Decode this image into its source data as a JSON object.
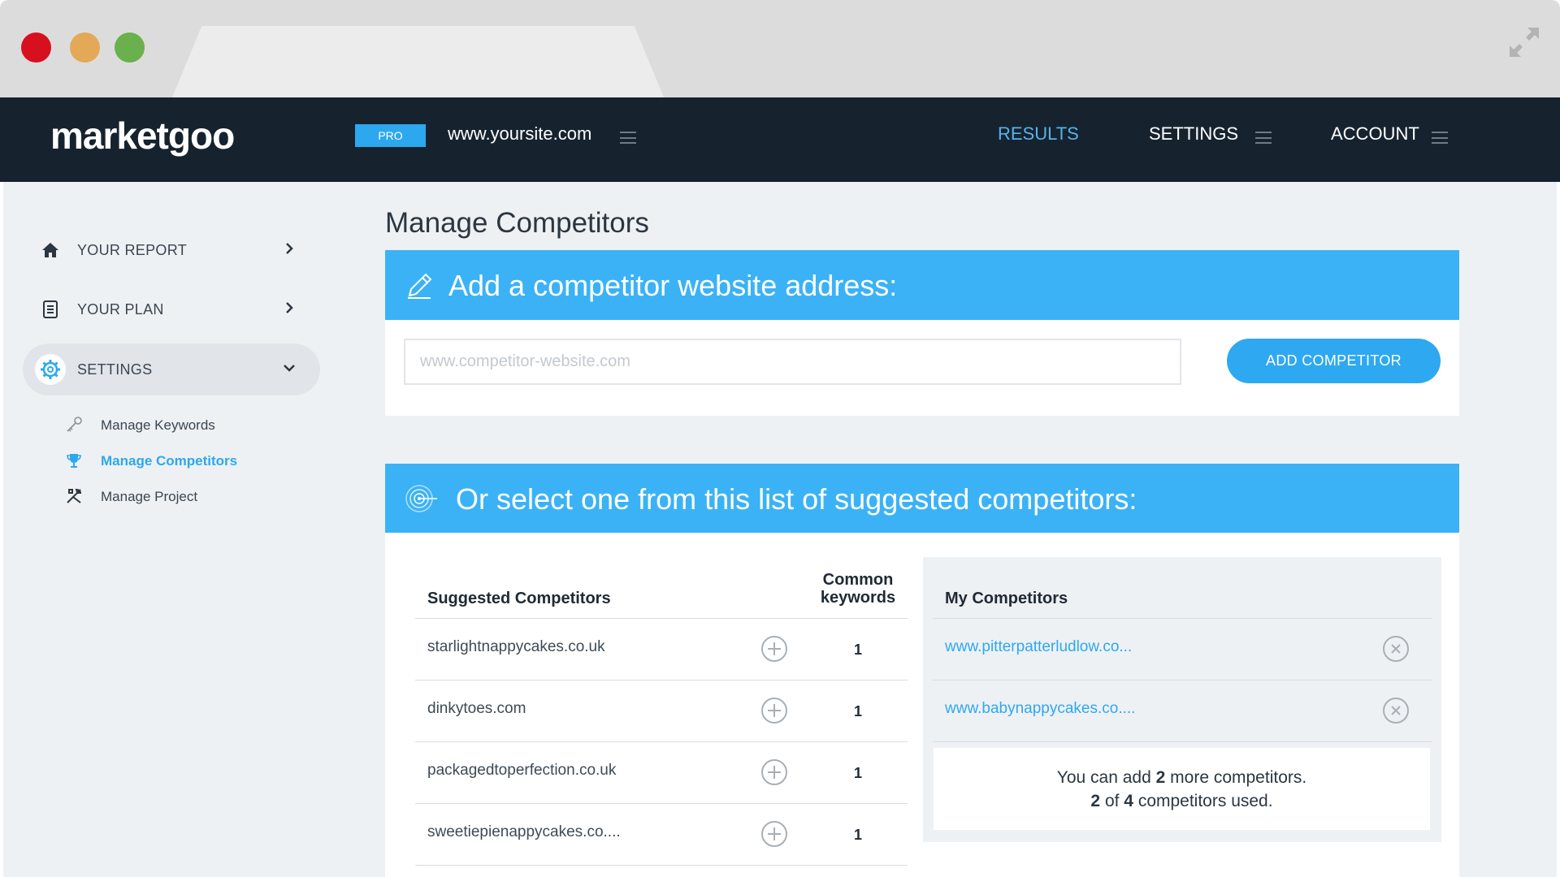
{
  "browser": {
    "window_buttons": [
      "close",
      "minimize",
      "maximize"
    ],
    "expand_icon": "expand-arrows-icon"
  },
  "header": {
    "logo": "marketgoo",
    "plan_badge": "PRO",
    "site": "www.yoursite.com",
    "nav": {
      "results": "RESULTS",
      "settings": "SETTINGS",
      "account": "ACCOUNT"
    }
  },
  "sidebar": {
    "items": [
      {
        "label": "YOUR REPORT",
        "icon": "home-icon"
      },
      {
        "label": "YOUR PLAN",
        "icon": "document-icon"
      },
      {
        "label": "SETTINGS",
        "icon": "gear-icon"
      }
    ],
    "sub_items": [
      {
        "label": "Manage Keywords",
        "icon": "key-icon"
      },
      {
        "label": "Manage Competitors",
        "icon": "trophy-icon"
      },
      {
        "label": "Manage Project",
        "icon": "tools-icon"
      }
    ]
  },
  "page": {
    "title": "Manage Competitors"
  },
  "add_panel": {
    "title": "Add a competitor website address:",
    "input_placeholder": "www.competitor-website.com",
    "button": "ADD COMPETITOR"
  },
  "suggest_panel": {
    "title": "Or select one from this list of suggested competitors:",
    "col_suggested": "Suggested Competitors",
    "col_common_1": "Common",
    "col_common_2": "keywords",
    "rows": [
      {
        "domain": "starlightnappycakes.co.uk",
        "common": "1"
      },
      {
        "domain": "dinkytoes.com",
        "common": "1"
      },
      {
        "domain": "packagedtoperfection.co.uk",
        "common": "1"
      },
      {
        "domain": "sweetiepienappycakes.co....",
        "common": "1"
      }
    ],
    "my_competitors": {
      "title": "My Competitors",
      "rows": [
        {
          "domain": "www.pitterpatterludlow.co..."
        },
        {
          "domain": "www.babynappycakes.co...."
        }
      ],
      "note": {
        "line1_pre": "You can add ",
        "line1_num": "2",
        "line1_post": " more competitors.",
        "line2_used": "2",
        "line2_of": " of ",
        "line2_total": "4",
        "line2_post": " competitors used."
      }
    }
  }
}
